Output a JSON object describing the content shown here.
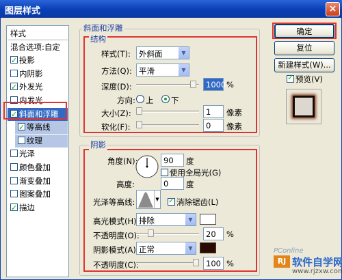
{
  "window": {
    "title": "图层样式",
    "close": "×"
  },
  "left_panel": {
    "items": [
      {
        "label": "样式",
        "checkbox": false
      },
      {
        "label": "混合选项:自定",
        "checkbox": false
      },
      {
        "label": "投影",
        "checked": true
      },
      {
        "label": "内阴影",
        "checked": false
      },
      {
        "label": "外发光",
        "checked": true
      },
      {
        "label": "内发光",
        "checked": false
      },
      {
        "label": "斜面和浮雕",
        "checked": true,
        "selected": true
      },
      {
        "label": "等高线",
        "checked": true,
        "sub": true
      },
      {
        "label": "纹理",
        "checked": false,
        "sub": true
      },
      {
        "label": "光泽",
        "checked": false
      },
      {
        "label": "颜色叠加",
        "checked": false
      },
      {
        "label": "渐变叠加",
        "checked": false
      },
      {
        "label": "图案叠加",
        "checked": false
      },
      {
        "label": "描边",
        "checked": true
      }
    ]
  },
  "bevel": {
    "title": "斜面和浮雕",
    "structure": {
      "title": "结构",
      "style_label": "样式(T):",
      "style_value": "外斜面",
      "method_label": "方法(Q):",
      "method_value": "平滑",
      "depth_label": "深度(D):",
      "depth_value": "1000",
      "depth_unit": "%",
      "depth_fraction": 0.95,
      "direction_label": "方向:",
      "up": "上",
      "down": "下",
      "direction_selected": "下",
      "size_label": "大小(Z):",
      "size_value": "1",
      "size_unit": "像素",
      "size_fraction": 0.0,
      "soften_label": "软化(F):",
      "soften_value": "0",
      "soften_unit": "像素",
      "soften_fraction": 0.0
    }
  },
  "shading": {
    "title": "阴影",
    "angle_label": "角度(N):",
    "angle_value": "90",
    "angle_unit": "度",
    "global_light": "使用全局光(G)",
    "global_light_checked": false,
    "altitude_label": "高度:",
    "altitude_value": "0",
    "altitude_unit": "度",
    "gloss_label": "光泽等高线:",
    "antialias": "消除锯齿(L)",
    "antialias_checked": true,
    "highlight_label": "高光模式(H):",
    "highlight_mode": "排除",
    "highlight_color": "#ffffff",
    "hl_opacity_label": "不透明度(O):",
    "hl_opacity_value": "20",
    "hl_opacity_unit": "%",
    "hl_opacity_fraction": 0.2,
    "shadow_label": "阴影模式(A):",
    "shadow_mode": "正常",
    "shadow_color": "#2b0a04",
    "sh_opacity_label": "不透明度(C):",
    "sh_opacity_value": "100",
    "sh_opacity_unit": "%",
    "sh_opacity_fraction": 1.0
  },
  "buttons": {
    "ok": "确定",
    "reset": "复位",
    "new_style": "新建样式(W)...",
    "preview": "预览(V)",
    "preview_checked": true
  },
  "watermark": {
    "logo": "软件自学网",
    "url": "www.rjzxw.com",
    "pconline": "PConline"
  }
}
